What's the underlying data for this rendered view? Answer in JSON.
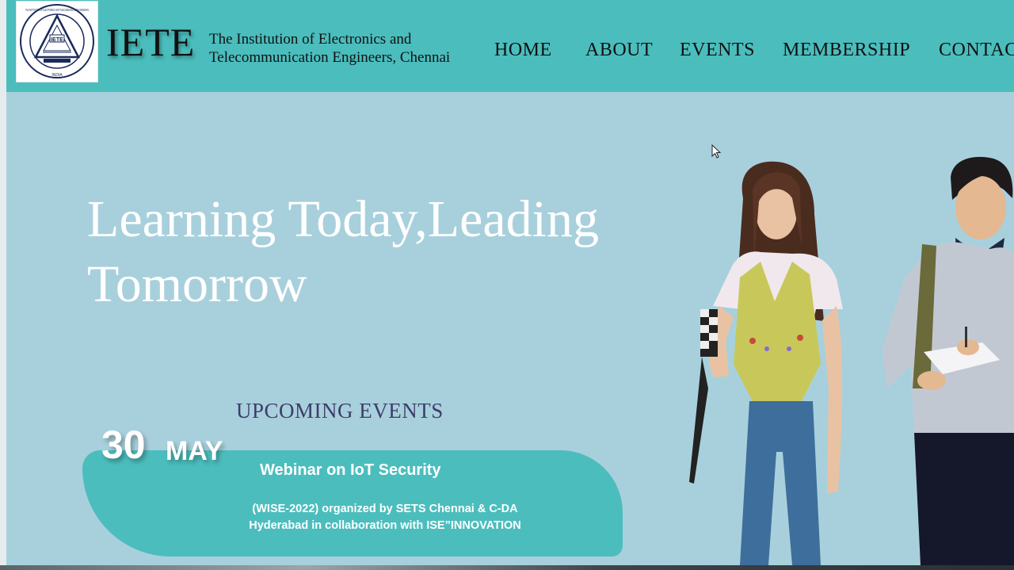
{
  "header": {
    "logo_icon": "iete-emblem-logo",
    "logo_ring_text_top": "THE INSTITUTION OF ELECTRONICS AND TELECOMMUNICATION ENGINEERS",
    "logo_ring_text_bottom": "INDIA",
    "logo_center": "IETE",
    "brand": "IETE",
    "institution_line1": "The Institution of Electronics and",
    "institution_line2": "Telecommunication Engineers, Chennai",
    "nav": [
      "HOME",
      "ABOUT",
      "EVENTS",
      "MEMBERSHIP",
      "CONTAC"
    ]
  },
  "hero": {
    "headline_line1": "Learning Today,Leading",
    "headline_line2": "Tomorrow",
    "image": "two-students-walking-photo"
  },
  "events": {
    "section_title": "UPCOMING EVENTS",
    "day": "30",
    "month": "MAY",
    "title": "Webinar on IoT Security",
    "description_line1": "(WISE-2022) organized by SETS Chennai & C-DA",
    "description_line2": "Hyderabad in collaboration with ISE”INNOVATION"
  },
  "colors": {
    "header_bg": "#4bbdbd",
    "hero_bg": "#a8d0dc",
    "card_bg": "#4cbdbd",
    "upcoming_text": "#3d3d6b"
  }
}
